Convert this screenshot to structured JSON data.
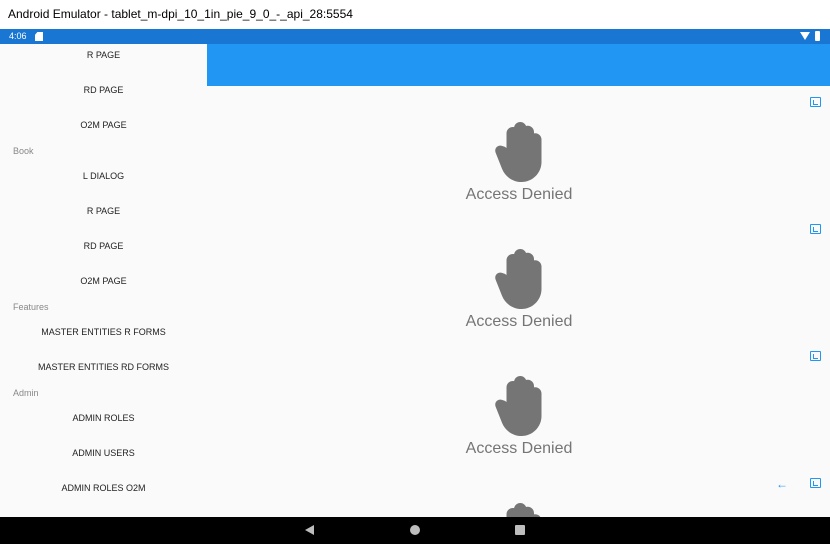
{
  "window": {
    "title": "Android Emulator - tablet_m-dpi_10_1in_pie_9_0_-_api_28:5554"
  },
  "status_bar": {
    "time": "4:06"
  },
  "drawer": {
    "items": [
      {
        "label": "R PAGE",
        "type": "item"
      },
      {
        "label": "RD PAGE",
        "type": "item"
      },
      {
        "label": "O2M PAGE",
        "type": "item"
      },
      {
        "label": "Book",
        "type": "header"
      },
      {
        "label": "L DIALOG",
        "type": "item"
      },
      {
        "label": "R PAGE",
        "type": "item"
      },
      {
        "label": "RD PAGE",
        "type": "item"
      },
      {
        "label": "O2M PAGE",
        "type": "item"
      },
      {
        "label": "Features",
        "type": "header"
      },
      {
        "label": "MASTER ENTITIES R FORMS",
        "type": "item"
      },
      {
        "label": "MASTER ENTITIES RD FORMS",
        "type": "item"
      },
      {
        "label": "Admin",
        "type": "header"
      },
      {
        "label": "ADMIN ROLES",
        "type": "item"
      },
      {
        "label": "ADMIN USERS",
        "type": "item"
      },
      {
        "label": "ADMIN ROLES O2M",
        "type": "item"
      }
    ]
  },
  "content": {
    "panels": [
      {
        "message": "Access Denied"
      },
      {
        "message": "Access Denied"
      },
      {
        "message": "Access Denied"
      }
    ]
  },
  "colors": {
    "app_bar": "#2196f3",
    "status_bar": "#1976d2",
    "icon_accent": "#2196f3",
    "denied_icon": "#757575"
  },
  "icons": {
    "panel_action": "open-in-panel-icon",
    "denied": "hand-stop-icon",
    "back": "arrow-left-icon"
  }
}
